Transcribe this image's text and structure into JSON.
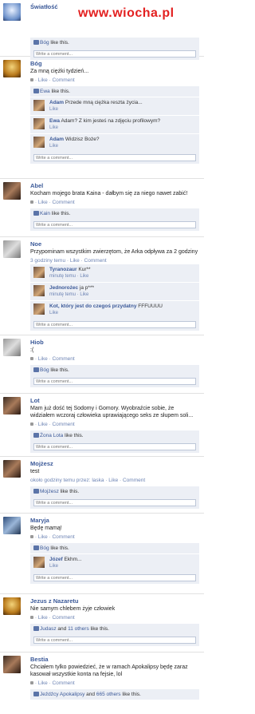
{
  "watermark": "www.wiocha.pl",
  "posts": [
    {
      "name": "Światłość",
      "text": "",
      "likes_who": "Bóg",
      "likes_rest": " like this.",
      "write": "Write a comment..."
    },
    {
      "name": "Bóg",
      "text": "Za mną ciężki tydzień...",
      "meta": "· Like · Comment",
      "likes_who": "Ewa",
      "likes_rest": " like this.",
      "comments": [
        {
          "name": "Adam",
          "text": "Przede mną ciężka reszta życia...",
          "like": "Like"
        },
        {
          "name": "Ewa",
          "text": "Adam? Z kim jesteś na zdjęciu profilowym?",
          "like": "Like"
        },
        {
          "name": "Adam",
          "text": "Widzisz Boże?",
          "like": "Like"
        }
      ],
      "write": "Write a comment..."
    },
    {
      "name": "Abel",
      "text": "Kocham mojego brata Kaina - dałbym się za niego nawet zabić!",
      "meta": "· Like · Comment",
      "likes_who": "Kain",
      "likes_rest": " like this.",
      "write": "Write a comment..."
    },
    {
      "name": "Noe",
      "text": "Przypominam wszystkim zwierzętom, że Arka odpływa za 2 godziny",
      "meta": "3 godziny temu · Like · Comment",
      "comments": [
        {
          "name": "Tyranozaur",
          "text": "Kur**",
          "sub": "minutę temu · Like"
        },
        {
          "name": "Jednorożec",
          "text": "ja p***",
          "sub": "minutę temu · Like"
        },
        {
          "name": "Kot, który jest do czegoś przydatny",
          "text": "FFFUUUU",
          "sub": "Like"
        }
      ],
      "write": "Write a comment..."
    },
    {
      "name": "Hiob",
      "text": ":(",
      "meta": "· Like · Comment",
      "likes_who": "Bóg",
      "likes_rest": " like this.",
      "write": "Write a comment..."
    },
    {
      "name": "Lot",
      "text": "Mam już dość tej Sodomy i Gomory. Wyobraźcie sobie, że widziałem wczoraj człowieka uprawiającego seks ze słupem soli...",
      "meta": "· Like · Comment",
      "likes_who": "Żona Lota",
      "likes_rest": " like this.",
      "write": "Write a comment..."
    },
    {
      "name": "Mojżesz",
      "text": "test",
      "meta": "około godziny temu przez: laska · Like · Comment",
      "likes_who": "Mojżesz",
      "likes_rest": " like this.",
      "write": "Write a comment..."
    },
    {
      "name": "Maryja",
      "text": "Będę mamą!",
      "meta": "· Like · Comment",
      "likes_who": "Bóg",
      "likes_rest": " like this.",
      "comments": [
        {
          "name": "Józef",
          "text": "Ekhm...",
          "like": "Like"
        }
      ],
      "write": "Write a comment..."
    },
    {
      "name": "Jezus z Nazaretu",
      "text": "Nie samym chlebem żyje człowiek",
      "meta": "· Like · Comment",
      "likes_who": "Judasz",
      "likes_mid": " and ",
      "likes_who2": "11 others",
      "likes_rest": " like this.",
      "write": "Write a comment..."
    },
    {
      "name": "Bestia",
      "text": "Chciałem tylko powiedzieć, że w ramach Apokalipsy będę zaraz kasował wszystkie konta na fejsie, lol",
      "meta": "· Like · Comment",
      "likes_who": "Jeźdźcy Apokalipsy",
      "likes_mid": " and ",
      "likes_who2": "665 others",
      "likes_rest": " like this."
    }
  ]
}
